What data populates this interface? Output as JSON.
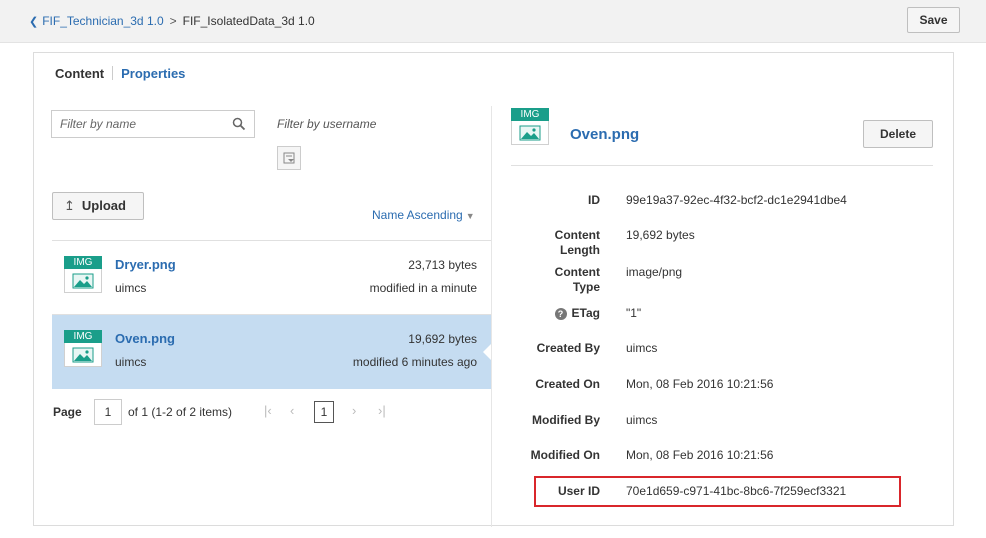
{
  "breadcrumb": {
    "parent": "FIF_Technician_3d 1.0",
    "separator": ">",
    "current": "FIF_IsolatedData_3d 1.0"
  },
  "toolbar": {
    "save_label": "Save"
  },
  "tabs": {
    "content": "Content",
    "properties": "Properties"
  },
  "filters": {
    "name_placeholder": "Filter by name",
    "username_label": "Filter by username"
  },
  "upload": {
    "label": "Upload"
  },
  "sort": {
    "label": "Name Ascending"
  },
  "files": [
    {
      "badge": "IMG",
      "name": "Dryer.png",
      "owner": "uimcs",
      "size": "23,713 bytes",
      "modified": "modified in a minute"
    },
    {
      "badge": "IMG",
      "name": "Oven.png",
      "owner": "uimcs",
      "size": "19,692 bytes",
      "modified": "modified 6 minutes ago"
    }
  ],
  "pager": {
    "label": "Page",
    "page": "1",
    "of_text": "of 1 (1-2 of 2 items)",
    "current": "1"
  },
  "detail": {
    "badge": "IMG",
    "title": "Oven.png",
    "delete_label": "Delete",
    "properties": [
      {
        "label": "ID",
        "value": "99e19a37-92ec-4f32-bcf2-dc1e2941dbe4"
      },
      {
        "label": "Content Length",
        "value": "19,692 bytes"
      },
      {
        "label": "Content Type",
        "value": "image/png"
      },
      {
        "label": "ETag",
        "value": "\"1\""
      },
      {
        "label": "Created By",
        "value": "uimcs"
      },
      {
        "label": "Created On",
        "value": "Mon, 08 Feb 2016 10:21:56"
      },
      {
        "label": "Modified By",
        "value": "uimcs"
      },
      {
        "label": "Modified On",
        "value": "Mon, 08 Feb 2016 10:21:56"
      },
      {
        "label": "User ID",
        "value": "70e1d659-c971-41bc-8bc6-7f259ecf3321"
      }
    ]
  },
  "colors": {
    "link": "#2b6cb0",
    "badge": "#1a9e8a",
    "selected_row": "#c5dcf1",
    "highlight": "#d9262b"
  },
  "icons": {
    "back": "chevron-left-icon",
    "search": "search-icon",
    "filter": "filter-icon",
    "upload": "upload-icon",
    "sort": "caret-down-icon",
    "image": "image-icon",
    "help": "question-circle-icon"
  }
}
